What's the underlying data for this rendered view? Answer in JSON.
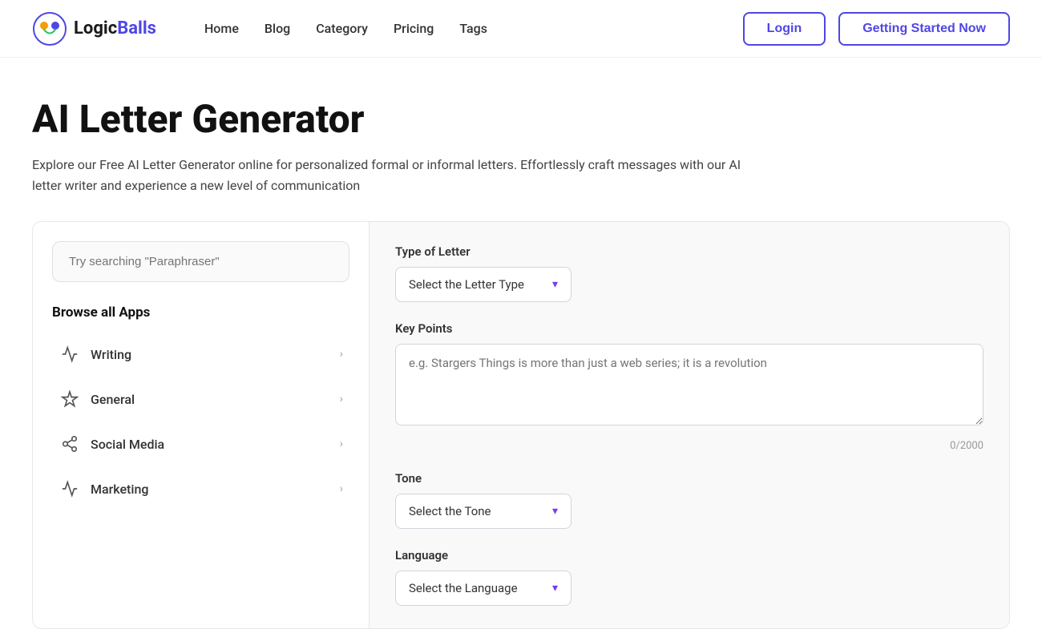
{
  "header": {
    "logo_logic": "Logic",
    "logo_balls": "Balls",
    "nav": [
      {
        "label": "Home",
        "href": "#"
      },
      {
        "label": "Blog",
        "href": "#"
      },
      {
        "label": "Category",
        "href": "#"
      },
      {
        "label": "Pricing",
        "href": "#"
      },
      {
        "label": "Tags",
        "href": "#"
      }
    ],
    "login_label": "Login",
    "started_label": "Getting Started Now"
  },
  "page": {
    "title": "AI Letter Generator",
    "description": "Explore our Free AI Letter Generator online for personalized formal or informal letters. Effortlessly craft messages with our AI letter writer and experience a new level of communication"
  },
  "sidebar": {
    "search_placeholder": "Try searching \"Paraphraser\"",
    "browse_title": "Browse all Apps",
    "items": [
      {
        "label": "Writing",
        "icon": "writing"
      },
      {
        "label": "General",
        "icon": "general"
      },
      {
        "label": "Social Media",
        "icon": "social-media"
      },
      {
        "label": "Marketing",
        "icon": "marketing"
      }
    ]
  },
  "form": {
    "type_of_letter_label": "Type of Letter",
    "type_of_letter_placeholder": "Select the Letter Type",
    "key_points_label": "Key Points",
    "key_points_placeholder": "e.g. Stargers Things is more than just a web series; it is a revolution",
    "key_points_counter": "0/2000",
    "tone_label": "Tone",
    "tone_placeholder": "Select the Tone",
    "language_label": "Language",
    "language_placeholder": "Select the Language"
  }
}
